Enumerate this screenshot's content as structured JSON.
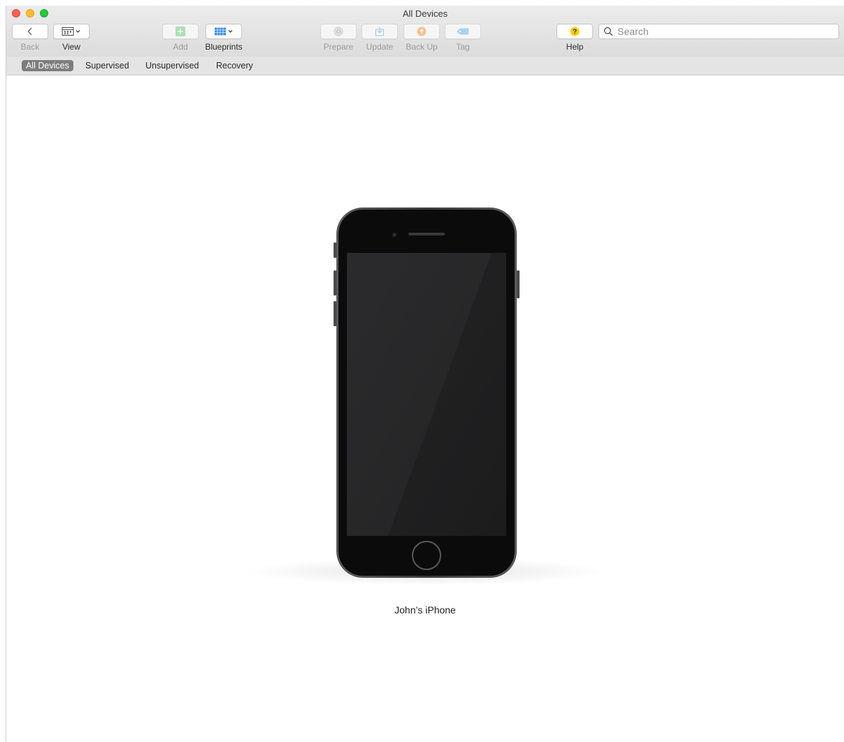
{
  "window": {
    "title": "All Devices"
  },
  "toolbar": {
    "back_label": "Back",
    "view_label": "View",
    "add_label": "Add",
    "blueprints_label": "Blueprints",
    "prepare_label": "Prepare",
    "update_label": "Update",
    "backup_label": "Back Up",
    "tag_label": "Tag",
    "help_label": "Help"
  },
  "search": {
    "placeholder": "Search",
    "value": ""
  },
  "scope_bar": {
    "items": [
      {
        "label": "All Devices",
        "selected": true
      },
      {
        "label": "Supervised",
        "selected": false
      },
      {
        "label": "Unsupervised",
        "selected": false
      },
      {
        "label": "Recovery",
        "selected": false
      }
    ]
  },
  "device": {
    "name": "John’s iPhone",
    "icon": "iphone-device-icon"
  },
  "colors": {
    "add_icon": "#5fcf6a",
    "blueprints_icon": "#3a8ee6",
    "backup_icon": "#f2994a",
    "tag_icon": "#5ab4f2",
    "help_icon": "#ffcc00",
    "scope_active_bg": "#7d7d7d"
  }
}
